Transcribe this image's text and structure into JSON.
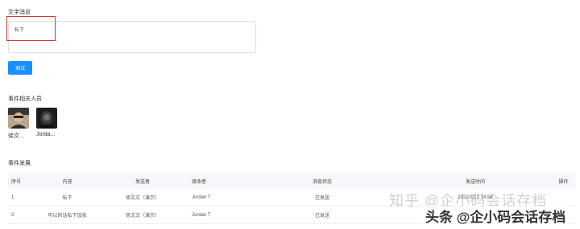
{
  "message_section": {
    "label": "文字消息",
    "textarea_value": "私下"
  },
  "send_button": {
    "label": "测试"
  },
  "people_section": {
    "label": "事件相关人员",
    "people": [
      {
        "name": "徐文..."
      },
      {
        "name": "Jorda..."
      }
    ]
  },
  "events_section": {
    "label": "事件发展",
    "table": {
      "headers": [
        "序号",
        "内容",
        "发送者",
        "接收者",
        "消息状态",
        "发送时间",
        "操作"
      ],
      "rows": [
        [
          "1",
          "私下",
          "徐文文（演示）",
          "Jordan T",
          "已发送",
          "2022/2/12 14:58",
          ""
        ],
        [
          "2",
          "可以的话私下加我",
          "徐文文（演示）",
          "Jordan T",
          "已发送",
          "",
          ""
        ]
      ]
    }
  },
  "watermarks": {
    "line1": "知乎 @企小码会话存档",
    "line2": "头条 @企小码会话存档"
  },
  "colors": {
    "primary": "#1890ff",
    "annotation_red": "#e0302e",
    "header_bg": "#f5f7fa"
  }
}
